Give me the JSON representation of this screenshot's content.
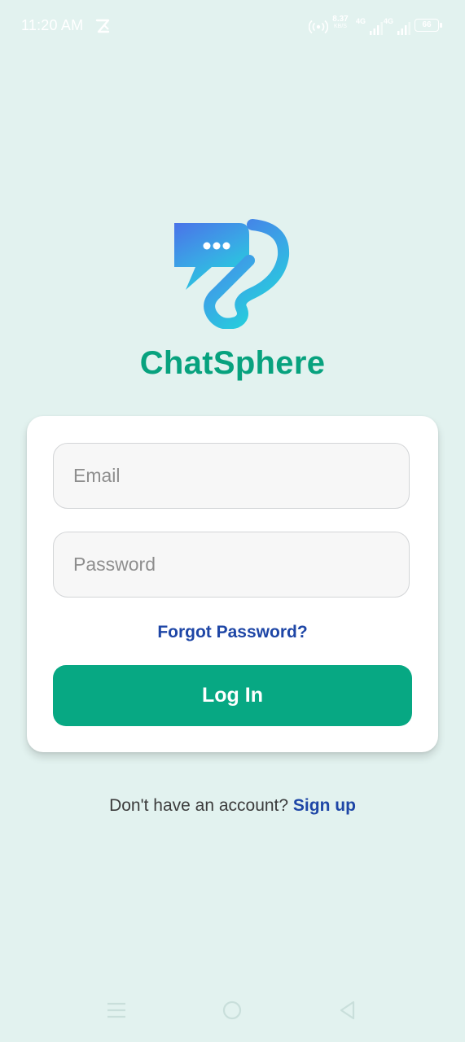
{
  "status_bar": {
    "time": "11:20 AM",
    "speed_top": "8.37",
    "speed_bottom": "KB/S",
    "network1": "4G",
    "network2": "4G",
    "battery": "66"
  },
  "app": {
    "name": "ChatSphere",
    "brand_color": "#07a27e",
    "logo_icon": "chat-bubble-logo-icon"
  },
  "login_form": {
    "email_placeholder": "Email",
    "email_value": "",
    "password_placeholder": "Password",
    "password_value": "",
    "forgot_password_label": "Forgot Password?",
    "login_button_label": "Log In"
  },
  "signup": {
    "prompt": "Don't have an account?",
    "link_label": "Sign up"
  },
  "nav": {
    "recent_icon": "menu-icon",
    "home_icon": "circle-home-icon",
    "back_icon": "back-triangle-icon"
  }
}
